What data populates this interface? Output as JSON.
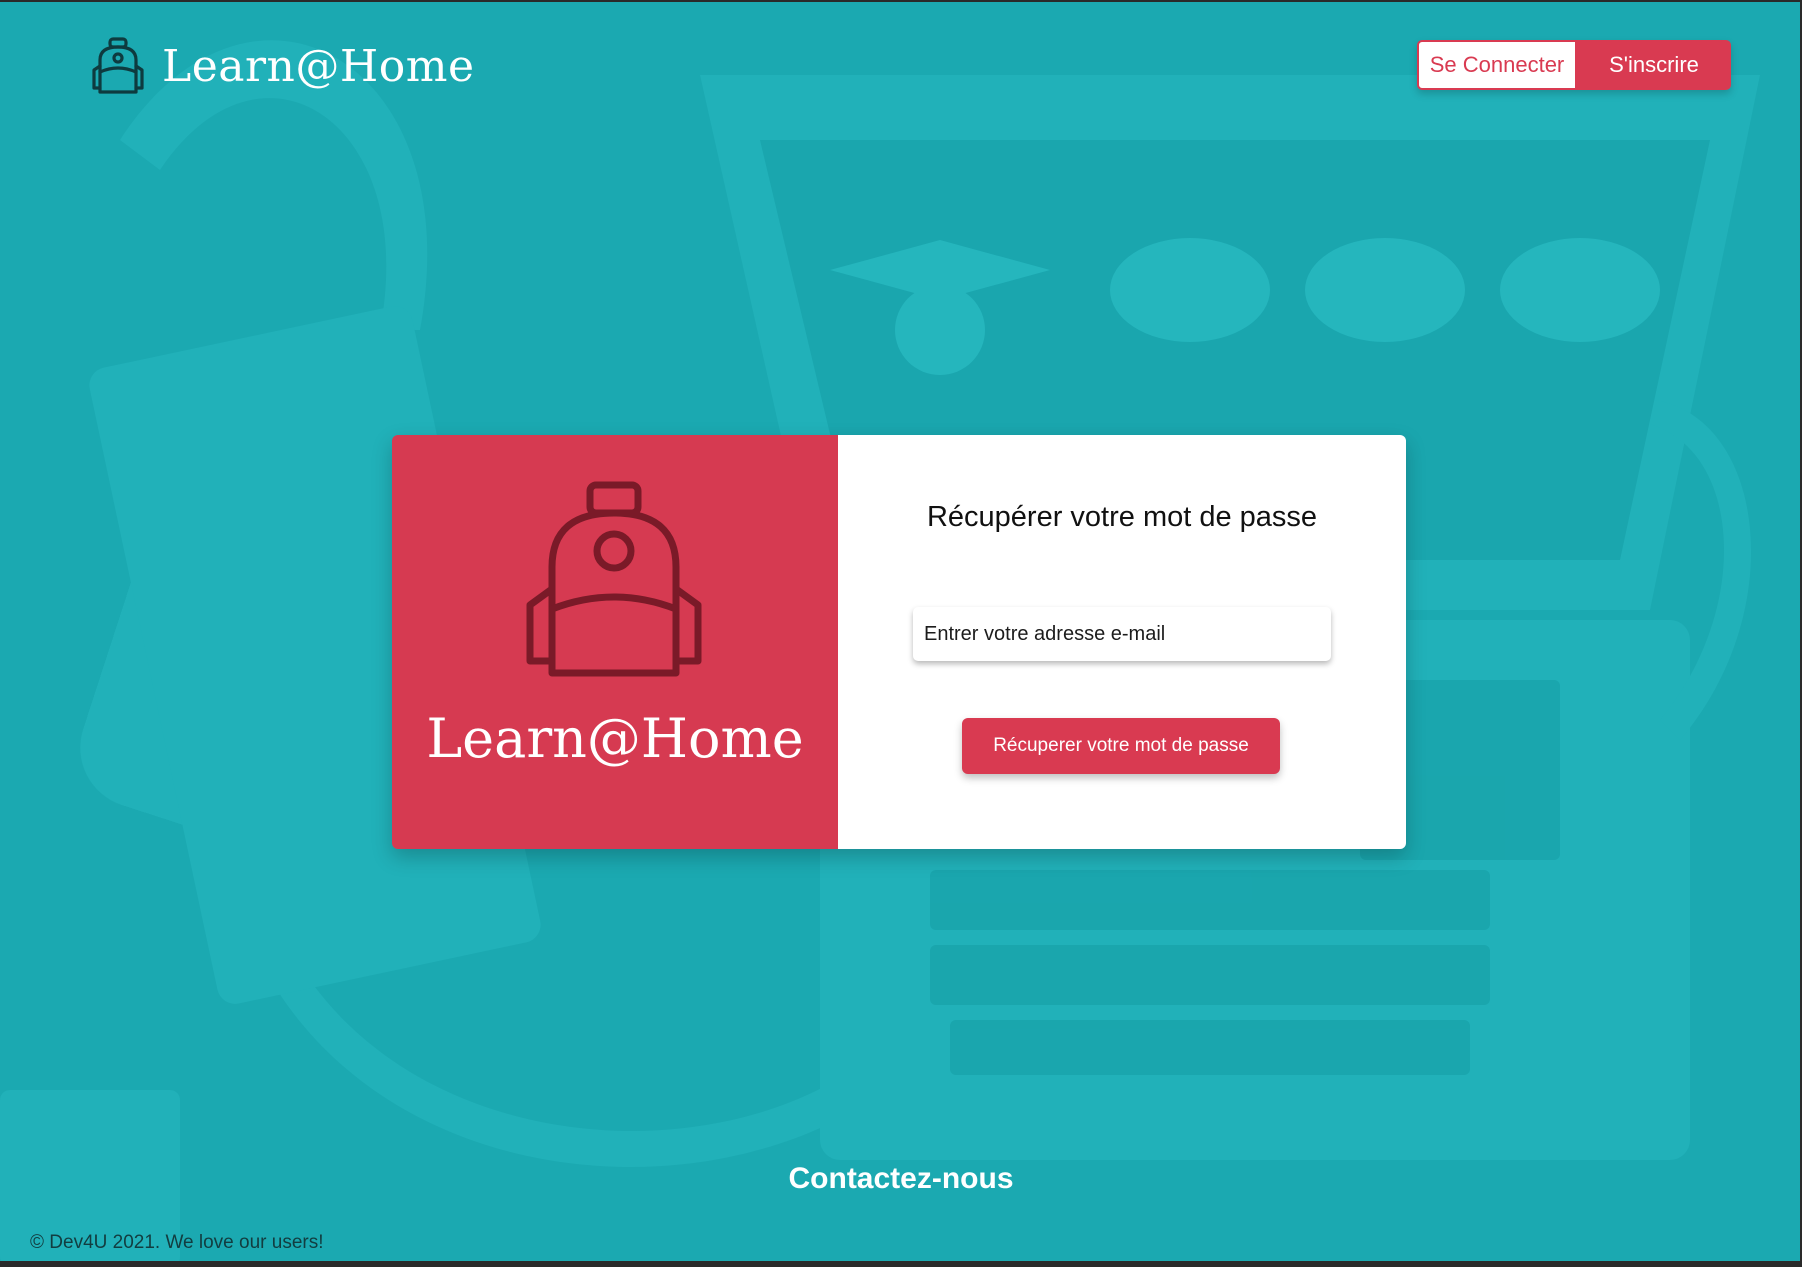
{
  "header": {
    "brand_name": "Learn@Home",
    "brand_icon": "backpack-icon",
    "login_label": "Se Connecter",
    "signup_label": "S'inscrire"
  },
  "card": {
    "left_title": "Learn@Home",
    "left_icon": "backpack-icon",
    "form_title": "Récupérer votre mot de passe",
    "email_placeholder": "Entrer votre adresse e-mail",
    "email_value": "",
    "submit_label": "Récuperer votre mot de passe"
  },
  "footer": {
    "contact_label": "Contactez-nous",
    "copyright": "© Dev4U 2021. We love our users!"
  },
  "colors": {
    "background": "#1ba9b1",
    "accent": "#d93a51",
    "card_left": "#d63a51",
    "icon_dark": "#7a1a28"
  }
}
